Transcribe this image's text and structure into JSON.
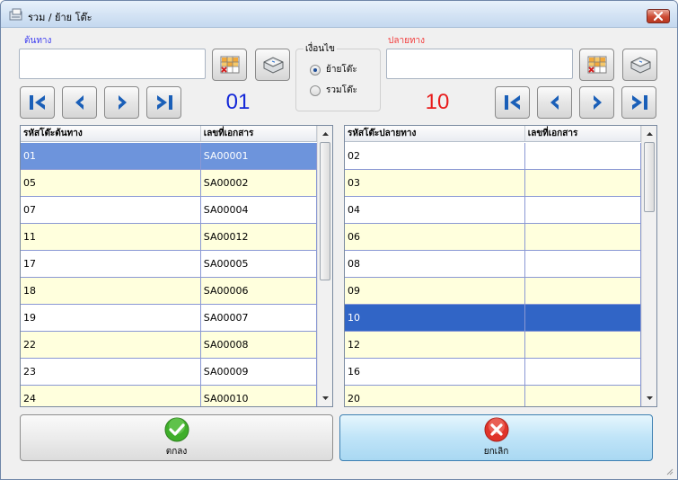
{
  "window": {
    "title": "รวม / ย้าย โต๊ะ",
    "close_icon": "close-icon"
  },
  "source": {
    "label": "ต้นทาง",
    "input_value": "",
    "table_number": "01"
  },
  "destination": {
    "label": "ปลายทาง",
    "input_value": "",
    "table_number": "10"
  },
  "condition": {
    "title": "เงื่อนไข",
    "options": [
      {
        "label": "ย้ายโต๊ะ",
        "selected": true
      },
      {
        "label": "รวมโต๊ะ",
        "selected": false
      }
    ]
  },
  "source_grid": {
    "headers": [
      "รหัสโต๊ะต้นทาง",
      "เลขที่เอกสาร"
    ],
    "rows": [
      [
        "01",
        "SA00001"
      ],
      [
        "05",
        "SA00002"
      ],
      [
        "07",
        "SA00004"
      ],
      [
        "11",
        "SA00012"
      ],
      [
        "17",
        "SA00005"
      ],
      [
        "18",
        "SA00006"
      ],
      [
        "19",
        "SA00007"
      ],
      [
        "22",
        "SA00008"
      ],
      [
        "23",
        "SA00009"
      ],
      [
        "24",
        "SA00010"
      ]
    ],
    "selected_row": 0
  },
  "destination_grid": {
    "headers": [
      "รหัสโต๊ะปลายทาง",
      "เลขที่เอกสาร"
    ],
    "rows": [
      [
        "02",
        ""
      ],
      [
        "03",
        ""
      ],
      [
        "04",
        ""
      ],
      [
        "06",
        ""
      ],
      [
        "08",
        ""
      ],
      [
        "09",
        ""
      ],
      [
        "10",
        ""
      ],
      [
        "12",
        ""
      ],
      [
        "16",
        ""
      ],
      [
        "20",
        ""
      ]
    ],
    "selected_row": 6
  },
  "buttons": {
    "ok_label": "ตกลง",
    "cancel_label": "ยกเลิก"
  },
  "colors": {
    "source_accent": "#1428d8",
    "destination_accent": "#e81c1c",
    "row_alt": "#ffffdd",
    "selected_row": "#3165c6"
  }
}
